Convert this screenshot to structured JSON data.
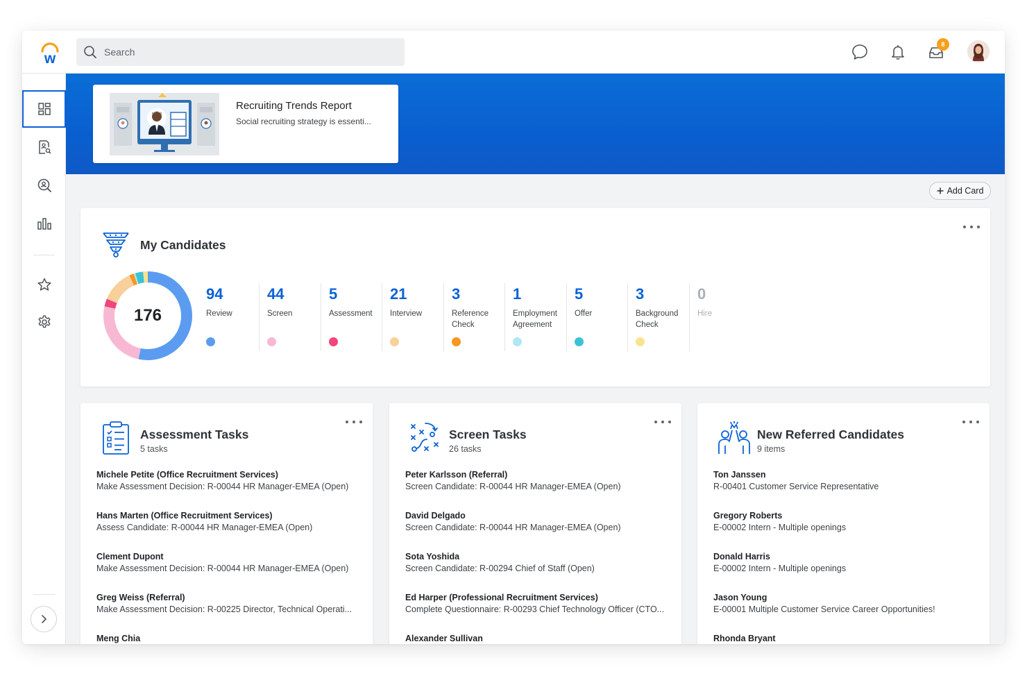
{
  "search": {
    "placeholder": "Search"
  },
  "notifications": {
    "inbox_badge": "8"
  },
  "hero": {
    "title": "Recruiting Trends Report",
    "subtitle": "Social recruiting strategy is essenti..."
  },
  "toolbar": {
    "add_card_label": "Add Card"
  },
  "candidates": {
    "title": "My Candidates",
    "total": "176",
    "stages": [
      {
        "count": "94",
        "label": "Review",
        "color": "#5b9cf0"
      },
      {
        "count": "44",
        "label": "Screen",
        "color": "#f7b8d3"
      },
      {
        "count": "5",
        "label": "Assessment",
        "color": "#f0467c"
      },
      {
        "count": "21",
        "label": "Interview",
        "color": "#f9cf9a"
      },
      {
        "count": "3",
        "label": "Reference Check",
        "color": "#f79620"
      },
      {
        "count": "1",
        "label": "Employment Agreement",
        "color": "#aee8f3"
      },
      {
        "count": "5",
        "label": "Offer",
        "color": "#3cc2d6"
      },
      {
        "count": "3",
        "label": "Background Check",
        "color": "#fbe28e"
      },
      {
        "count": "0",
        "label": "Hire",
        "color": "#d8dbdf"
      }
    ]
  },
  "assessment_tasks": {
    "title": "Assessment Tasks",
    "subtitle": "5 tasks",
    "items": [
      {
        "name": "Michele Petite (Office Recruitment Services)",
        "detail": "Make Assessment Decision: R-00044 HR Manager-EMEA (Open)"
      },
      {
        "name": "Hans Marten (Office Recruitment Services)",
        "detail": "Assess Candidate: R-00044 HR Manager-EMEA (Open)"
      },
      {
        "name": "Clement Dupont",
        "detail": "Make Assessment Decision: R-00044 HR Manager-EMEA (Open)"
      },
      {
        "name": "Greg Weiss (Referral)",
        "detail": "Make Assessment Decision: R-00225 Director, Technical Operati..."
      },
      {
        "name": "Meng Chia",
        "detail": ""
      }
    ]
  },
  "screen_tasks": {
    "title": "Screen Tasks",
    "subtitle": "26 tasks",
    "items": [
      {
        "name": "Peter Karlsson (Referral)",
        "detail": "Screen Candidate: R-00044 HR Manager-EMEA (Open)"
      },
      {
        "name": "David Delgado",
        "detail": "Screen Candidate: R-00044 HR Manager-EMEA (Open)"
      },
      {
        "name": "Sota Yoshida",
        "detail": "Screen Candidate: R-00294 Chief of Staff (Open)"
      },
      {
        "name": "Ed Harper (Professional Recruitment Services)",
        "detail": "Complete Questionnaire: R-00293 Chief Technology Officer (CTO..."
      },
      {
        "name": "Alexander Sullivan",
        "detail": ""
      }
    ]
  },
  "referred_candidates": {
    "title": "New Referred Candidates",
    "subtitle": "9 items",
    "items": [
      {
        "name": "Ton Janssen",
        "detail": "R-00401 Customer Service Representative"
      },
      {
        "name": "Gregory Roberts",
        "detail": "E-00002 Intern - Multiple openings"
      },
      {
        "name": "Donald Harris",
        "detail": "E-00002 Intern - Multiple openings"
      },
      {
        "name": "Jason Young",
        "detail": "E-00001 Multiple Customer Service Career Opportunities!"
      },
      {
        "name": "Rhonda Bryant",
        "detail": ""
      }
    ]
  },
  "colors": {
    "accent": "#0b62d6",
    "hero_blue": "#0a66d2",
    "logo_orange": "#f6a01a"
  }
}
